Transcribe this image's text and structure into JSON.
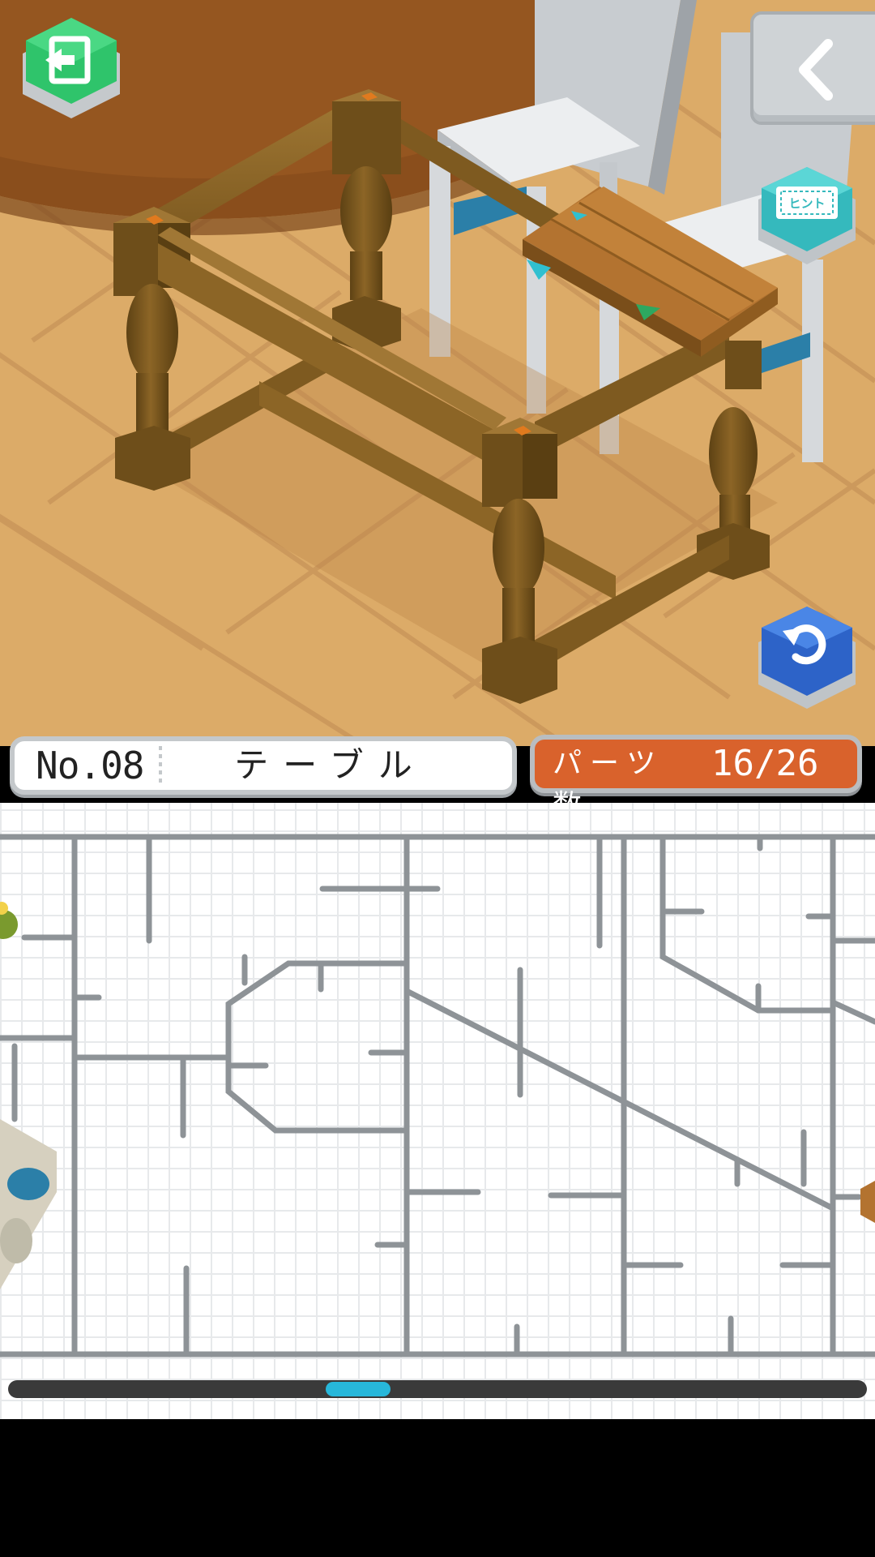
{
  "level": {
    "number": "No.08",
    "name": "テーブル"
  },
  "parts": {
    "label": "パーツ数",
    "count": "16/26",
    "placed": 16,
    "total": 26
  },
  "buttons": {
    "exit_icon": "exit-door-icon",
    "back_icon": "chevron-left-icon",
    "hint_label": "ヒント",
    "undo_icon": "undo-arrow-icon"
  },
  "tray": {
    "scroll_position": 0.4
  },
  "colors": {
    "exit_button": "#2fc46b",
    "hint_button": "#3cc8c8",
    "undo_button": "#2d63c8",
    "parts_panel": "#d9622c",
    "scroll_thumb": "#27b7da",
    "floor": "#d9a865",
    "wood": "#8a6223"
  }
}
